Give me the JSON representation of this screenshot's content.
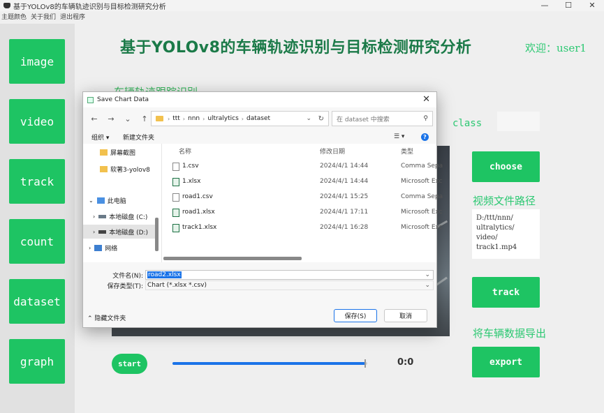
{
  "window": {
    "title": "基于YOLOv8的车辆轨迹识别与目标检测研究分析",
    "controls": {
      "minimize": "—",
      "maximize": "☐",
      "close": "✕"
    }
  },
  "menu": [
    "主题颜色",
    "关于我们",
    "退出程序"
  ],
  "sidebar": {
    "items": [
      {
        "label": "image"
      },
      {
        "label": "video"
      },
      {
        "label": "track"
      },
      {
        "label": "count"
      },
      {
        "label": "dataset"
      },
      {
        "label": "graph"
      }
    ]
  },
  "main": {
    "title": "基于YOLOv8的车辆轨迹识别与目标检测研究分析",
    "welcome": "欢迎：user1",
    "subtitle": "车辆轨迹跟踪识别",
    "class_label": "class",
    "class_value": "",
    "choose_label": "choose",
    "video_path_label": "视频文件路径",
    "video_path": "D:/ttt/nnn/\nultralytics/\nvideo/\ntrack1.mp4",
    "track_label": "track",
    "export_heading": "将车辆数据导出",
    "export_label": "export",
    "start_label": "start",
    "progress": 0.99,
    "time": "0:0"
  },
  "dialog": {
    "title": "Save Chart Data",
    "close": "✕",
    "nav": {
      "back": "←",
      "forward": "→",
      "recent": "⌄",
      "up": "↑"
    },
    "path": [
      "ttt",
      "nnn",
      "ultralytics",
      "dataset"
    ],
    "search_placeholder": "在 dataset 中搜索",
    "toolbar": {
      "organize": "组织 ▾",
      "new_folder": "新建文件夹",
      "view": "☰ ▾",
      "help": "?"
    },
    "nav_items": [
      {
        "label": "屏幕截图",
        "icon": "folder-icon",
        "indent": 1
      },
      {
        "label": "软著3-yolov8",
        "icon": "folder-icon",
        "indent": 1
      },
      {
        "label": "此电脑",
        "icon": "computer-icon",
        "indent": 0,
        "expanded": true
      },
      {
        "label": "本地磁盘 (C:)",
        "icon": "drive-icon",
        "indent": 1
      },
      {
        "label": "本地磁盘 (D:)",
        "icon": "drive-icon",
        "indent": 1,
        "selected": true
      },
      {
        "label": "网络",
        "icon": "network-icon",
        "indent": 0
      }
    ],
    "columns": {
      "name": "名称",
      "date": "修改日期",
      "type": "类型"
    },
    "files": [
      {
        "name": "1.csv",
        "date": "2024/4/1 14:44",
        "type": "Comma Sepa",
        "kind": "csv"
      },
      {
        "name": "1.xlsx",
        "date": "2024/4/1 14:44",
        "type": "Microsoft Exc",
        "kind": "xlsx"
      },
      {
        "name": "road1.csv",
        "date": "2024/4/1 15:25",
        "type": "Comma Sepa",
        "kind": "csv"
      },
      {
        "name": "road1.xlsx",
        "date": "2024/4/1 17:11",
        "type": "Microsoft Exc",
        "kind": "xlsx"
      },
      {
        "name": "track1.xlsx",
        "date": "2024/4/1 16:28",
        "type": "Microsoft Exc",
        "kind": "xlsx"
      }
    ],
    "filename_label": "文件名(N):",
    "filename_value": "road2.xlsx",
    "filetype_label": "保存类型(T):",
    "filetype_value": "Chart (*.xlsx *.csv)",
    "hide_folders": "隐藏文件夹",
    "save_label": "保存(S)",
    "cancel_label": "取消"
  },
  "colors": {
    "accent_green": "#1ec463",
    "title_green": "#1b7a48",
    "highlight_blue": "#1a73e8"
  }
}
